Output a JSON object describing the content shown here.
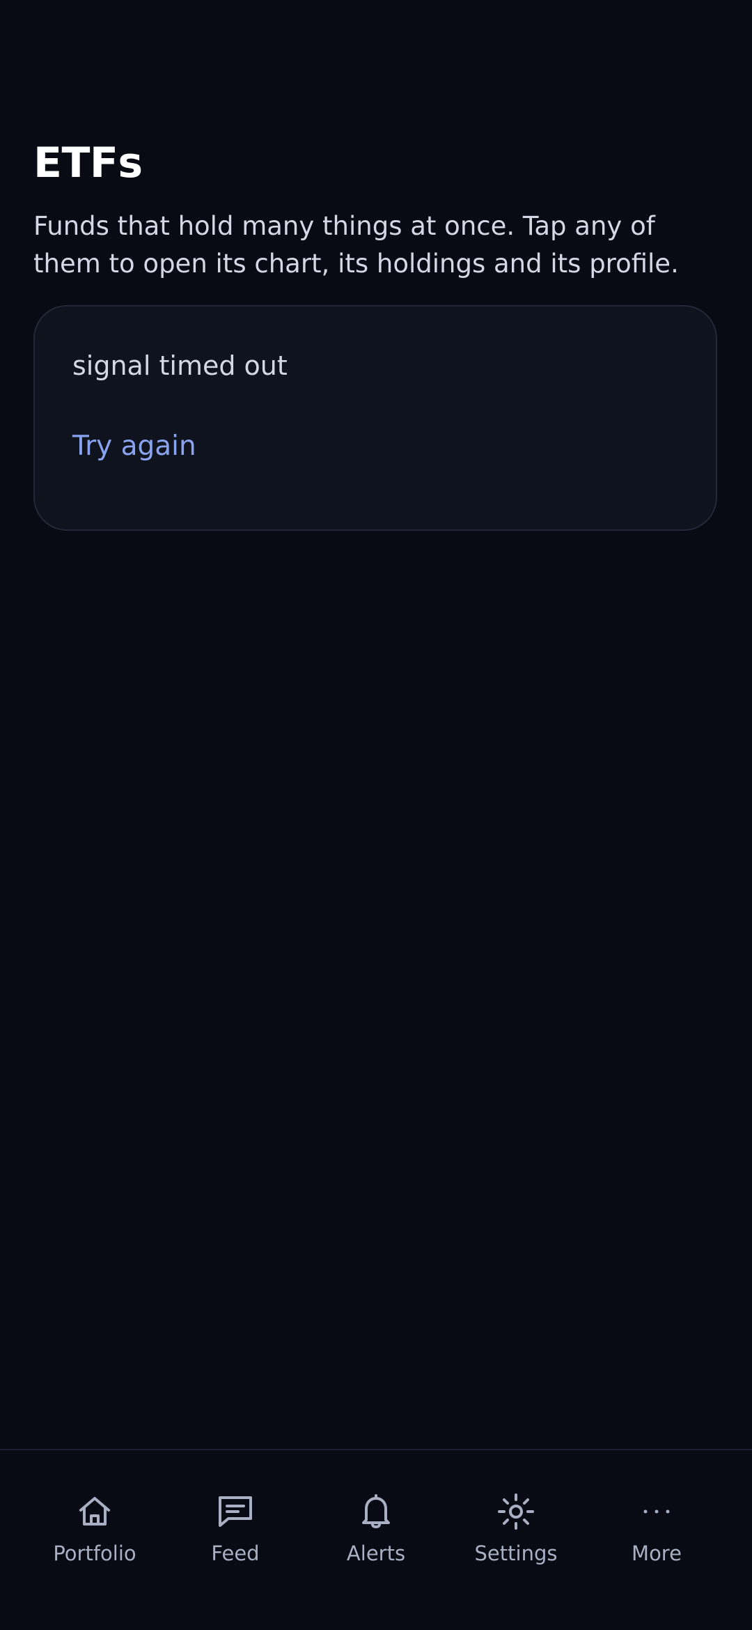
{
  "header": {
    "title": "ETFs",
    "subtitle": "Funds that hold many things at once. Tap any of them to open its chart, its holdings and its profile."
  },
  "error_card": {
    "message": "signal timed out",
    "retry_label": "Try again"
  },
  "bottom_nav": {
    "items": [
      {
        "label": "Portfolio",
        "icon": "home-icon"
      },
      {
        "label": "Feed",
        "icon": "message-icon"
      },
      {
        "label": "Alerts",
        "icon": "bell-icon"
      },
      {
        "label": "Settings",
        "icon": "sun-icon"
      },
      {
        "label": "More",
        "icon": "ellipsis-icon"
      }
    ]
  },
  "colors": {
    "background": "#080b14",
    "card": "#0f131d",
    "accent": "#8aa3f0",
    "muted": "#a9b0c4"
  }
}
